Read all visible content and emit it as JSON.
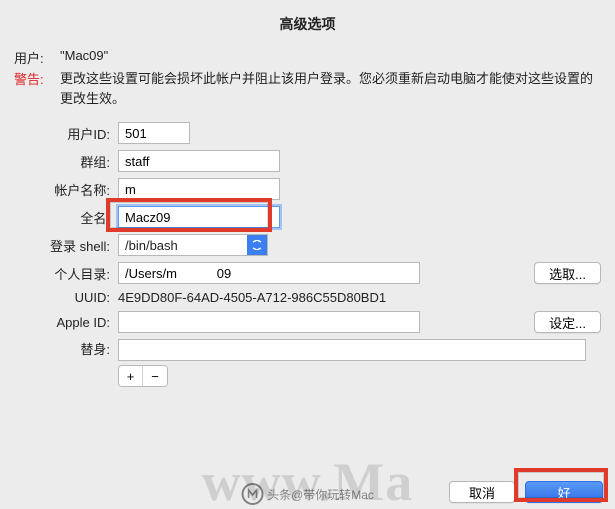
{
  "title": "高级选项",
  "user": {
    "label": "用户:",
    "value": "\"Mac09\""
  },
  "warning": {
    "label": "警告:",
    "text": "更改这些设置可能会损坏此帐户并阻止该用户登录。您必须重新启动电脑才能使对这些设置的更改生效。"
  },
  "fields": {
    "userid": {
      "label": "用户ID:",
      "value": "501"
    },
    "group": {
      "label": "群组:",
      "value": "staff"
    },
    "account": {
      "label": "帐户名称:",
      "value": "m"
    },
    "fullname": {
      "label": "全名:",
      "value": "Macz09"
    },
    "shell": {
      "label": "登录 shell:",
      "value": "/bin/bash"
    },
    "home": {
      "label": "个人目录:",
      "value": "/Users/m           09",
      "button": "选取..."
    },
    "uuid": {
      "label": "UUID:",
      "value": "4E9DD80F-64AD-4505-A712-986C55D80BD1"
    },
    "appleid": {
      "label": "Apple ID:",
      "value": "",
      "button": "设定..."
    },
    "aliases": {
      "label": "替身:",
      "value": ""
    }
  },
  "plusminus": {
    "add": "+",
    "remove": "−"
  },
  "footer": {
    "cancel": "取消",
    "ok": "好"
  },
  "watermark": "www.Ma",
  "toutiao": "头条@带你玩转Mac"
}
